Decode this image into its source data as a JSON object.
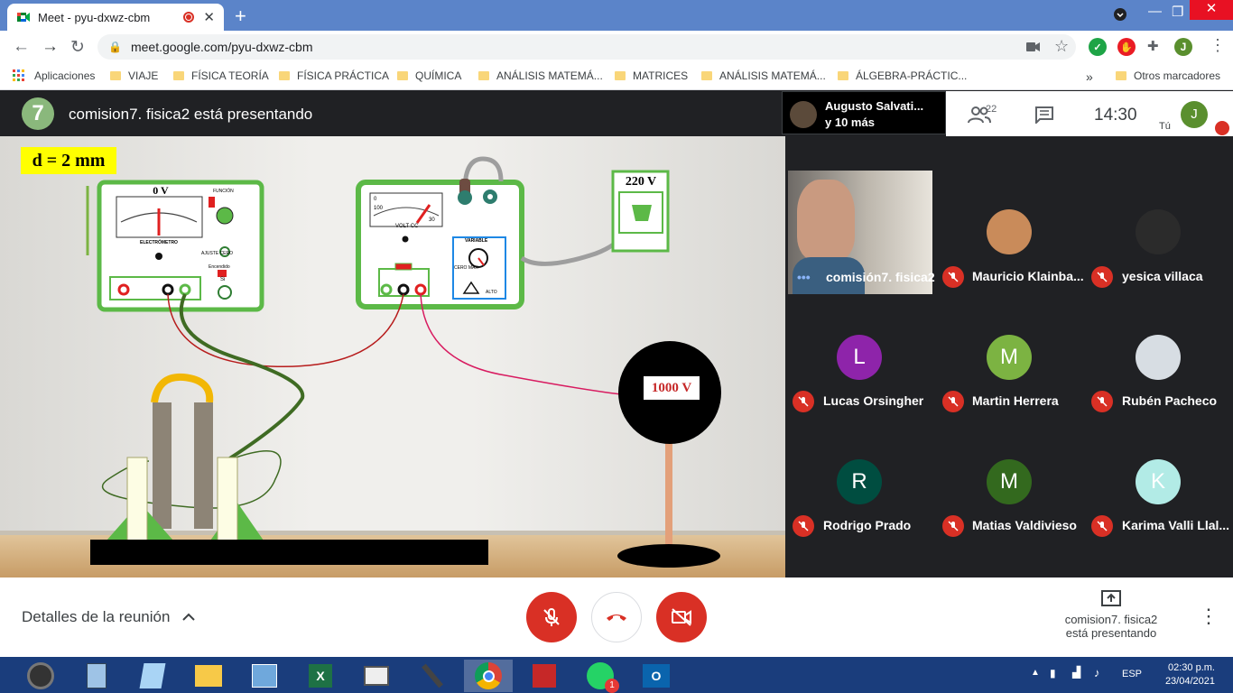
{
  "browser": {
    "tab_title": "Meet - pyu-dxwz-cbm",
    "url": "meet.google.com/pyu-dxwz-cbm",
    "profile_initial": "J"
  },
  "bookmarks": {
    "apps_label": "Aplicaciones",
    "items": [
      "VIAJE",
      "FÍSICA TEORÍA",
      "FÍSICA PRÁCTICA",
      "QUÍMICA",
      "ANÁLISIS MATEMÁ...",
      "MATRICES",
      "ANÁLISIS MATEMÁ...",
      "ÁLGEBRA-PRÁCTIC..."
    ],
    "more": "»",
    "other": "Otros marcadores"
  },
  "meet": {
    "presenting_title": "comision7. fisica2 está presentando",
    "presenter_name": "Augusto Salvati...",
    "presenter_more": "y 10 más",
    "people_count": "22",
    "time": "14:30",
    "self_label": "Tú",
    "self_initial": "J",
    "details_label": "Detalles de la reunión",
    "presenting_note_line1": "comision7. fisica2",
    "presenting_note_line2": "está presentando"
  },
  "slide": {
    "gap_label": "d = 2 mm",
    "electrometer_reading": "0 V",
    "outlet_label": "220 V",
    "sphere_label": "1000 V",
    "electrometer_title": "ELECTRÓMETRO",
    "funcion_label": "FUNCIÓN",
    "volt_cc_label": "VOLT CC",
    "variable_label": "VARIABLE",
    "ajuste_cero": "AJUSTE CERO",
    "encendido": "Encendido",
    "si": "Si",
    "cero_max": "CERO MAX",
    "alto": "ALTO",
    "scale_zero": "0",
    "scale_mid": "100",
    "scale_max": "30"
  },
  "participants": [
    {
      "name": "comisión7. fisica2",
      "type": "video"
    },
    {
      "name": "Mauricio Klainba...",
      "type": "photo",
      "color": "#c98b5a"
    },
    {
      "name": "yesica villaca",
      "type": "photo",
      "color": "#3a3a3a"
    },
    {
      "name": "Lucas Orsingher",
      "initial": "L",
      "color": "#8e24aa"
    },
    {
      "name": "Martin Herrera",
      "initial": "M",
      "color": "#7cb342"
    },
    {
      "name": "Rubén Pacheco",
      "type": "photo",
      "color": "#d7dde3"
    },
    {
      "name": "Rodrigo Prado",
      "initial": "R",
      "color": "#004d40"
    },
    {
      "name": "Matias Valdivieso",
      "initial": "M",
      "color": "#33691e"
    },
    {
      "name": "Karima Valli Llal...",
      "initial": "K",
      "color": "#b2ebe6"
    }
  ],
  "taskbar": {
    "lang": "ESP",
    "time": "02:30 p.m.",
    "date": "23/04/2021",
    "whatsapp_badge": "1"
  }
}
